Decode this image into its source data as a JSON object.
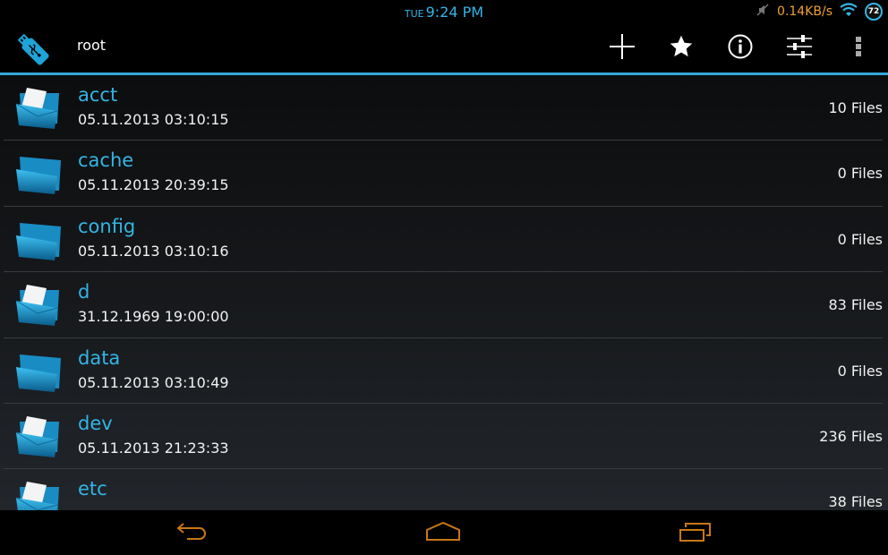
{
  "status_bar": {
    "day": "TUE",
    "time": "9:24 PM",
    "net_speed": "0.14KB/s",
    "battery_level": "72",
    "icons": [
      "muted-icon",
      "wifi-icon",
      "battery-icon"
    ]
  },
  "action_bar": {
    "title": "root",
    "app_icon": "usb-drive-icon",
    "actions": [
      {
        "name": "add",
        "icon": "plus-icon"
      },
      {
        "name": "bookmarks",
        "icon": "star-icon"
      },
      {
        "name": "info",
        "icon": "info-icon"
      },
      {
        "name": "settings",
        "icon": "sliders-icon"
      },
      {
        "name": "overflow",
        "icon": "overflow-menu-icon"
      }
    ]
  },
  "files": [
    {
      "name": "acct",
      "date": "05.11.2013 03:10:15",
      "count": "10 Files",
      "icon": "folder-with-files-icon"
    },
    {
      "name": "cache",
      "date": "05.11.2013 20:39:15",
      "count": "0 Files",
      "icon": "empty-folder-icon"
    },
    {
      "name": "config",
      "date": "05.11.2013 03:10:16",
      "count": "0 Files",
      "icon": "empty-folder-icon"
    },
    {
      "name": "d",
      "date": "31.12.1969 19:00:00",
      "count": "83 Files",
      "icon": "folder-with-files-icon"
    },
    {
      "name": "data",
      "date": "05.11.2013 03:10:49",
      "count": "0 Files",
      "icon": "empty-folder-icon"
    },
    {
      "name": "dev",
      "date": "05.11.2013 21:23:33",
      "count": "236 Files",
      "icon": "folder-with-files-icon"
    },
    {
      "name": "etc",
      "date": "",
      "count": "38 Files",
      "icon": "folder-with-files-icon"
    }
  ],
  "nav_bar": {
    "buttons": [
      "back",
      "home",
      "recent-apps"
    ]
  },
  "colors": {
    "accent": "#33b5e5",
    "net_speed": "#f0a030",
    "nav_buttons": "#c87814"
  }
}
